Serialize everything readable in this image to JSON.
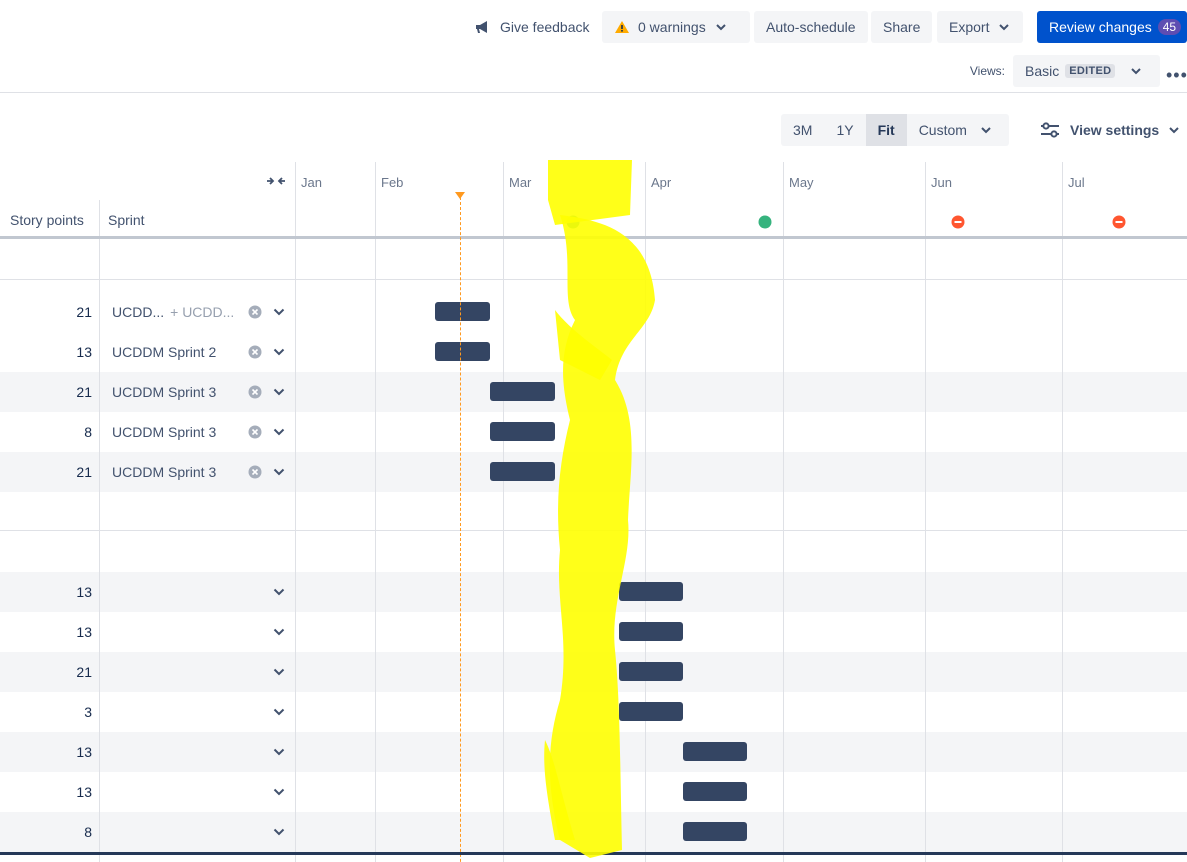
{
  "toolbar": {
    "feedback_label": "Give feedback",
    "warnings_label": "0 warnings",
    "autoschedule_label": "Auto-schedule",
    "share_label": "Share",
    "export_label": "Export",
    "review_label": "Review changes",
    "review_count": "45"
  },
  "views": {
    "label": "Views:",
    "selected": "Basic",
    "edited_badge": "EDITED",
    "more": "•••"
  },
  "zoom": {
    "options": [
      "3M",
      "1Y",
      "Fit",
      "Custom"
    ],
    "active": "Fit",
    "view_settings_label": "View settings"
  },
  "columns": {
    "story_points": "Story points",
    "sprint": "Sprint"
  },
  "months": [
    "Jan",
    "Feb",
    "Mar",
    "Apr",
    "May",
    "Jun",
    "Jul"
  ],
  "rows_group1": [
    {
      "points": "21",
      "sprint": "UCDD...",
      "sprint_extra": "+ UCDD..."
    },
    {
      "points": "13",
      "sprint": "UCDDM Sprint 2",
      "sprint_extra": ""
    },
    {
      "points": "21",
      "sprint": "UCDDM Sprint 3",
      "sprint_extra": ""
    },
    {
      "points": "8",
      "sprint": "UCDDM Sprint 3",
      "sprint_extra": ""
    },
    {
      "points": "21",
      "sprint": "UCDDM Sprint 3",
      "sprint_extra": ""
    }
  ],
  "rows_group2": [
    {
      "points": "13"
    },
    {
      "points": "13"
    },
    {
      "points": "21"
    },
    {
      "points": "3"
    },
    {
      "points": "13"
    },
    {
      "points": "13"
    },
    {
      "points": "8"
    }
  ],
  "colors": {
    "primary": "#0052cc",
    "bar": "#344563",
    "today_marker": "#ff991f",
    "milestone_done": "#36b37e",
    "milestone_blocked": "#ff5630",
    "scribble": "#ffff00"
  }
}
